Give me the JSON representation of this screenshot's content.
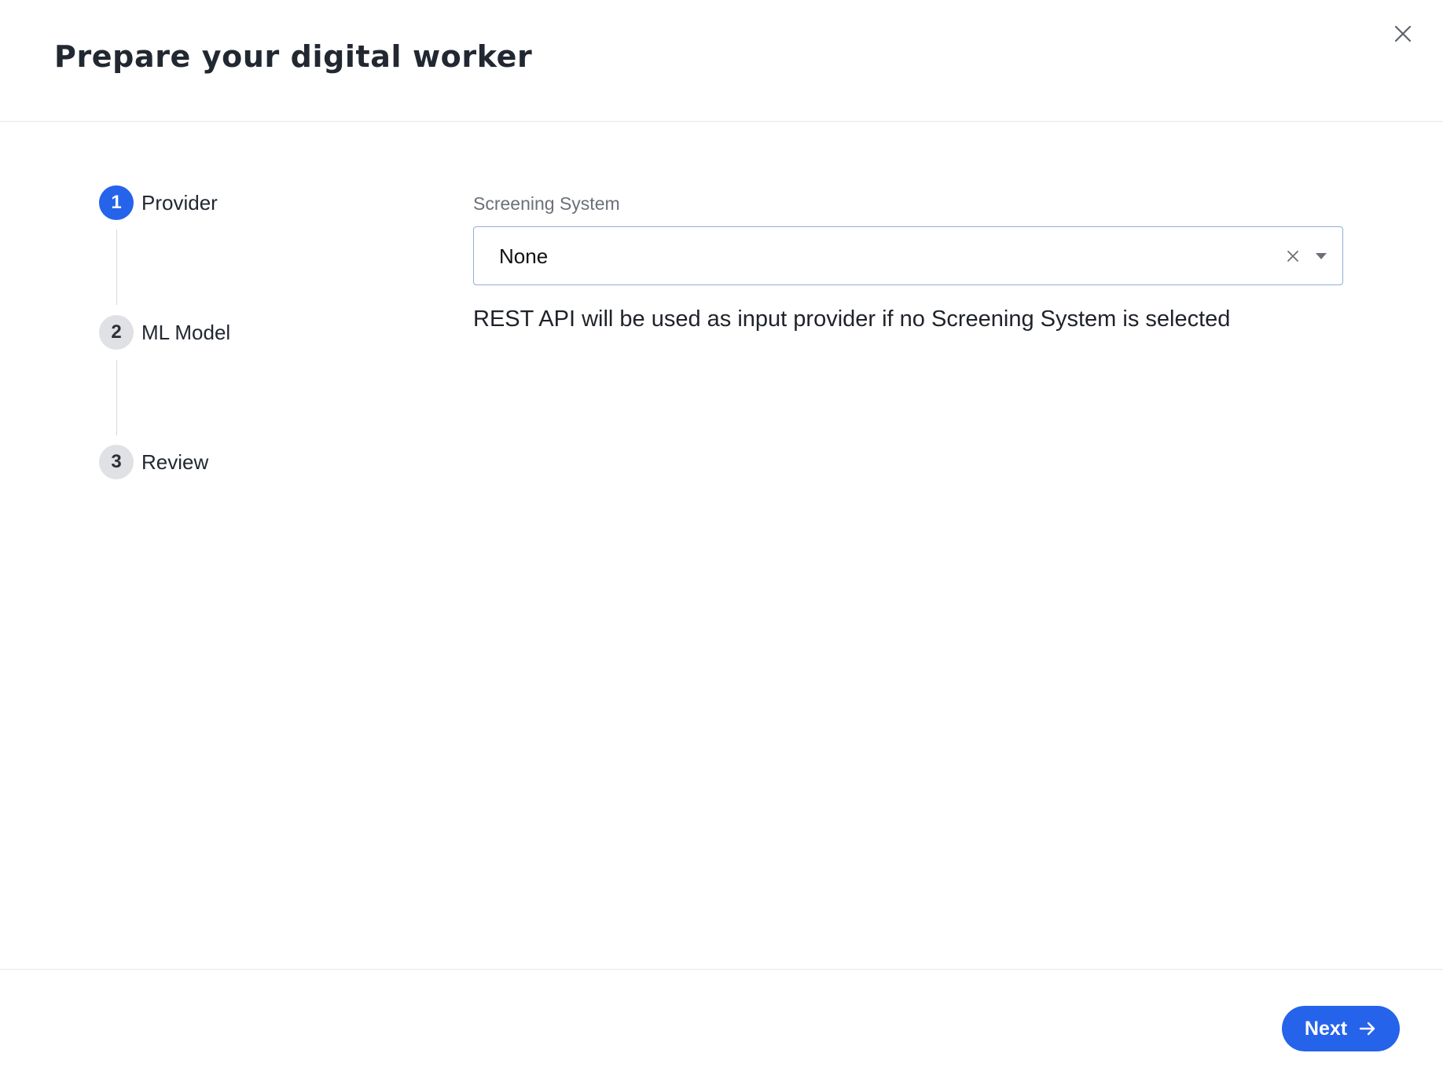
{
  "dialog": {
    "title": "Prepare your digital worker",
    "close_icon": "close-icon"
  },
  "stepper": {
    "steps": [
      {
        "number": "1",
        "label": "Provider",
        "active": true
      },
      {
        "number": "2",
        "label": "ML Model",
        "active": false
      },
      {
        "number": "3",
        "label": "Review",
        "active": false
      }
    ]
  },
  "form": {
    "screening_system": {
      "label": "Screening System",
      "value": "None",
      "clear_icon": "clear-icon",
      "dropdown_icon": "caret-down-icon"
    },
    "helper_text": "REST API will be used as input provider if no Screening System is selected"
  },
  "footer": {
    "next_label": "Next",
    "next_icon": "arrow-right-icon"
  },
  "colors": {
    "accent": "#2563eb",
    "inactive_step": "#dfe1e4",
    "select_border": "#93aed8",
    "divider": "#e6e8eb"
  }
}
